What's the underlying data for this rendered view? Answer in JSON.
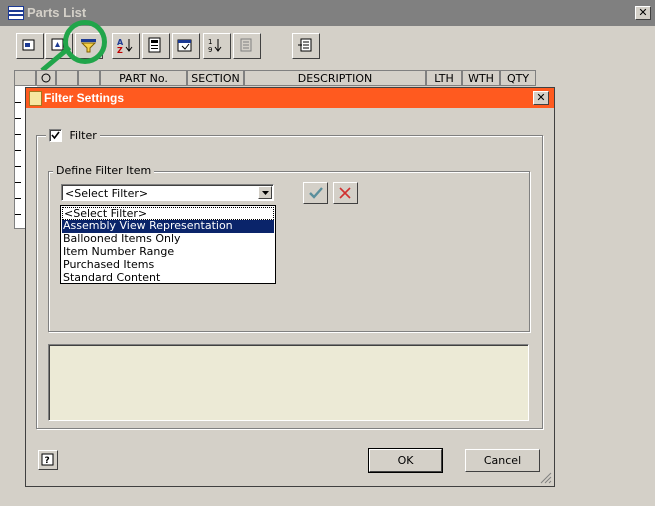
{
  "parts_list": {
    "title": "Parts List",
    "columns": [
      "",
      "PART No.",
      "SECTION",
      "DESCRIPTION",
      "LTH",
      "WTH",
      "QTY"
    ],
    "toolbar_icons": [
      "insert-row-icon",
      "expand-icon",
      "filter-icon",
      "sort-az-icon",
      "report-icon",
      "properties-icon",
      "sort-numeric-icon",
      "renumber-icon",
      "export-icon"
    ]
  },
  "dialog": {
    "title": "Filter Settings",
    "filter_checkbox": {
      "label": "Filter",
      "checked": true
    },
    "define_group_label": "Define Filter Item",
    "select": {
      "value": "<Select Filter>"
    },
    "options": [
      "<Select Filter>",
      "Assembly View Representation",
      "Ballooned Items Only",
      "Item Number Range",
      "Purchased Items",
      "Standard Content"
    ],
    "selected_option_index": 1,
    "ok_label": "OK",
    "cancel_label": "Cancel"
  },
  "colors": {
    "dialog_title_bar": "#ff5a1f",
    "highlight": "#0a246a",
    "annotation_ring": "#21a54a",
    "message_area": "#ecead6"
  }
}
